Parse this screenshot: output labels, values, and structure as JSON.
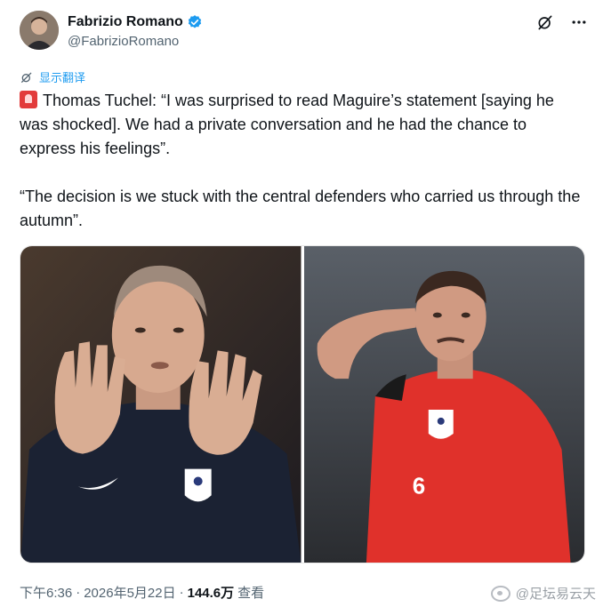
{
  "author": {
    "display_name": "Fabrizio Romano",
    "handle": "@FabrizioRomano",
    "verified": true
  },
  "actions": {
    "grok_icon": "grok-icon",
    "more_icon": "more-icon"
  },
  "translate": {
    "label": "显示翻译",
    "icon": "translate-icon"
  },
  "tweet": {
    "paragraph1_prefix_icon": "siren-emoji",
    "paragraph1": "Thomas Tuchel: “I was surprised to read Maguire’s statement [saying he was shocked]. We had a private conversation and he had the chance to express his feelings”.",
    "paragraph2": "“The decision is we stuck with the central defenders who carried us through the autumn”."
  },
  "media": {
    "left_photo": "Thomas Tuchel gesturing with both hands raised",
    "right_photo": "Harry Maguire in red England kit number 6 with hand on head",
    "right_kit_number": "6"
  },
  "meta": {
    "time": "下午6:36",
    "separator": "·",
    "date": "2026年5月22日",
    "views_count": "144.6万",
    "views_label": "查看"
  },
  "watermark": {
    "text": "@足坛易云天"
  },
  "colors": {
    "accent": "#1d9bf0",
    "text": "#0f1419",
    "secondary": "#536471",
    "kit_red": "#e0312b"
  }
}
